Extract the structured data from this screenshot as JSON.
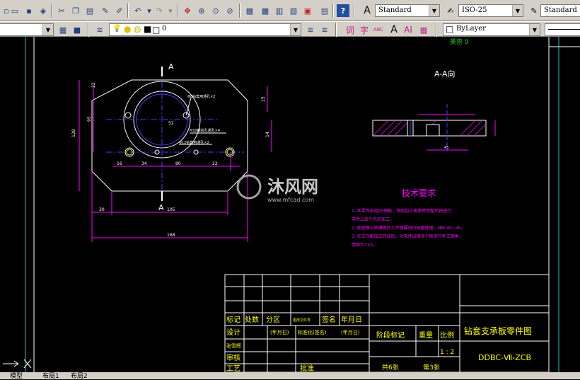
{
  "toolbar1": {
    "text_style_combo": "Standard",
    "dim_style_combo": "ISO-25",
    "table_style_combo": "Standard"
  },
  "toolbar2": {
    "layer_value": "0",
    "layer_icons": [
      "lightbulb-icon",
      "sun-icon",
      "lock-icon",
      "color-square-icon"
    ],
    "text_buttons": [
      "词",
      "字",
      "ABC",
      "AI"
    ],
    "color_combo": "ByLayer"
  },
  "drawing": {
    "section_label_top": "A",
    "section_label_bottom": "A",
    "section_view_title": "A-A向",
    "technical_title": "技术要求",
    "tech_notes": [
      "1. 本零件采用45钢板，铣削加工表面并修整后再进行",
      "   零件上各个孔的加工。",
      "2. 底座面与钻模板的工件面要进行研磨处理。HRC40~45。",
      "3. 在工作图加工完成后，对零件边缘各个棱进行手工倒角，",
      "   倒角为1×1。"
    ],
    "watermark_main": "沐风网",
    "watermark_url": "www.mfcad.com",
    "top_label": "美兽 9"
  },
  "dimensions": {
    "w105": "105",
    "w168": "168",
    "w30": "30",
    "w80": "80",
    "w34": "34",
    "w16": "16",
    "w22": "22",
    "h128": "128",
    "h95": "95",
    "h15": "15",
    "h14": "14",
    "h22": "22",
    "d52": "52",
    "s45": "45",
    "note1": "Φ8钻套用通孔×2",
    "note2": "Φ12钻套用通孔×2",
    "note3": "M10螺纹孔通孔×4"
  },
  "title_block": {
    "header_cells": [
      "标记",
      "处数",
      "分区",
      "更改文件号",
      "签名",
      "年月日"
    ],
    "sign_row": [
      "(年月日)",
      "标准化(签名)",
      "(年月日)"
    ],
    "rows": [
      "设计",
      "张雪辉",
      "审核",
      "工艺"
    ],
    "stage_mark": "阶段标记",
    "weight": "重量",
    "scale": "比例",
    "scale_value": "1 : 2",
    "drawing_name": "钻套支承板零件图",
    "drawing_code": "DDBC-Ⅶ-ZCB",
    "sheets_total": "共6张",
    "sheet_current": "第3张",
    "approve": "批准"
  },
  "tabs": {
    "model": "模型",
    "layout1": "布局1",
    "layout2": "布局2"
  }
}
